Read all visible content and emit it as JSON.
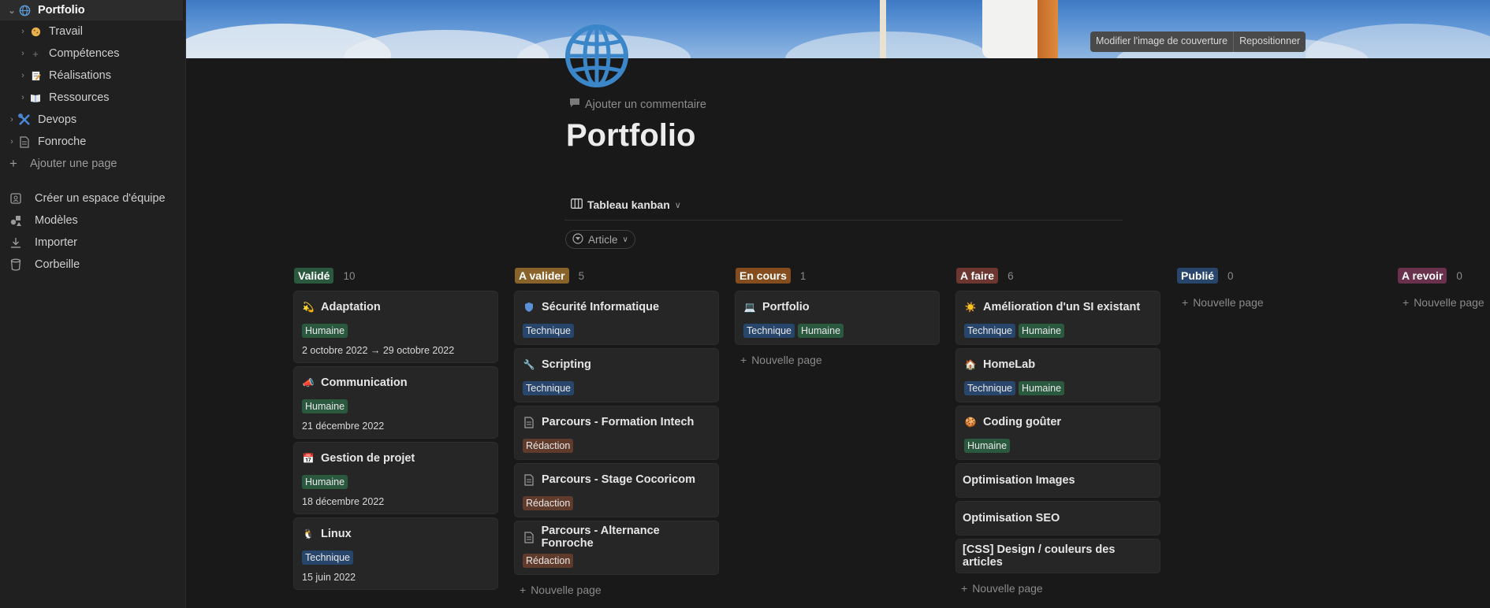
{
  "sidebar": {
    "items": [
      {
        "label": "Portfolio",
        "icon": "globe-icon"
      },
      {
        "label": "Travail",
        "icon": "cookie-icon"
      },
      {
        "label": "Compétences",
        "icon": "plus-icon"
      },
      {
        "label": "Réalisations",
        "icon": "memo-icon"
      },
      {
        "label": "Ressources",
        "icon": "book-icon"
      },
      {
        "label": "Devops",
        "icon": "tools-icon"
      },
      {
        "label": "Fonroche",
        "icon": "document-icon"
      },
      {
        "label": "Ajouter une page",
        "icon": "plus-icon"
      }
    ],
    "actions": [
      {
        "label": "Créer un espace d'équipe",
        "icon": "team-icon"
      },
      {
        "label": "Modèles",
        "icon": "shapes-icon"
      },
      {
        "label": "Importer",
        "icon": "download-icon"
      },
      {
        "label": "Corbeille",
        "icon": "trash-icon"
      }
    ]
  },
  "cover": {
    "change_label": "Modifier l'image de couverture",
    "reposition_label": "Repositionner"
  },
  "page": {
    "add_comment": "Ajouter un commentaire",
    "title": "Portfolio",
    "view_label": "Tableau kanban",
    "filter_label": "Article"
  },
  "board": {
    "new_page": "Nouvelle page",
    "columns": [
      {
        "status": "Validé",
        "count": "10",
        "color": "#2b593f",
        "cards": [
          {
            "title": "Adaptation",
            "icon": "sparkle-icon",
            "tags": [
              "Humaine"
            ],
            "date": "2 octobre 2022 → 29 octobre 2022"
          },
          {
            "title": "Communication",
            "icon": "megaphone-icon",
            "tags": [
              "Humaine"
            ],
            "date": "21 décembre 2022"
          },
          {
            "title": "Gestion de projet",
            "icon": "calendar-icon",
            "tags": [
              "Humaine"
            ],
            "date": "18 décembre 2022"
          },
          {
            "title": "Linux",
            "icon": "penguin-icon",
            "tags": [
              "Technique"
            ],
            "date": "15 juin 2022"
          }
        ]
      },
      {
        "status": "A valider",
        "count": "5",
        "color": "#89632a",
        "cards": [
          {
            "title": "Sécurité Informatique",
            "icon": "shield-icon",
            "tags": [
              "Technique"
            ]
          },
          {
            "title": "Scripting",
            "icon": "wrench-icon",
            "tags": [
              "Technique"
            ]
          },
          {
            "title": "Parcours - Formation Intech",
            "icon": "document-icon",
            "tags": [
              "Rédaction"
            ]
          },
          {
            "title": "Parcours - Stage Cocoricom",
            "icon": "document-icon",
            "tags": [
              "Rédaction"
            ]
          },
          {
            "title": "Parcours - Alternance Fonroche",
            "icon": "document-icon",
            "tags": [
              "Rédaction"
            ]
          }
        ]
      },
      {
        "status": "En cours",
        "count": "1",
        "color": "#854c1d",
        "cards": [
          {
            "title": "Portfolio",
            "icon": "laptop-icon",
            "tags": [
              "Technique",
              "Humaine"
            ]
          }
        ]
      },
      {
        "status": "A faire",
        "count": "6",
        "color": "#6e3630",
        "cards": [
          {
            "title": "Amélioration d'un SI existant",
            "icon": "sun-icon",
            "tags": [
              "Technique",
              "Humaine"
            ]
          },
          {
            "title": "HomeLab",
            "icon": "house-icon",
            "tags": [
              "Technique",
              "Humaine"
            ]
          },
          {
            "title": "Coding goûter",
            "icon": "cookie-icon",
            "tags": [
              "Humaine"
            ]
          },
          {
            "title": "Optimisation Images"
          },
          {
            "title": "Optimisation SEO"
          },
          {
            "title": "[CSS] Design / couleurs des articles"
          }
        ]
      },
      {
        "status": "Publié",
        "count": "0",
        "color": "#28456c",
        "cards": []
      },
      {
        "status": "A revoir",
        "count": "0",
        "color": "#69314c",
        "cards": []
      }
    ]
  }
}
